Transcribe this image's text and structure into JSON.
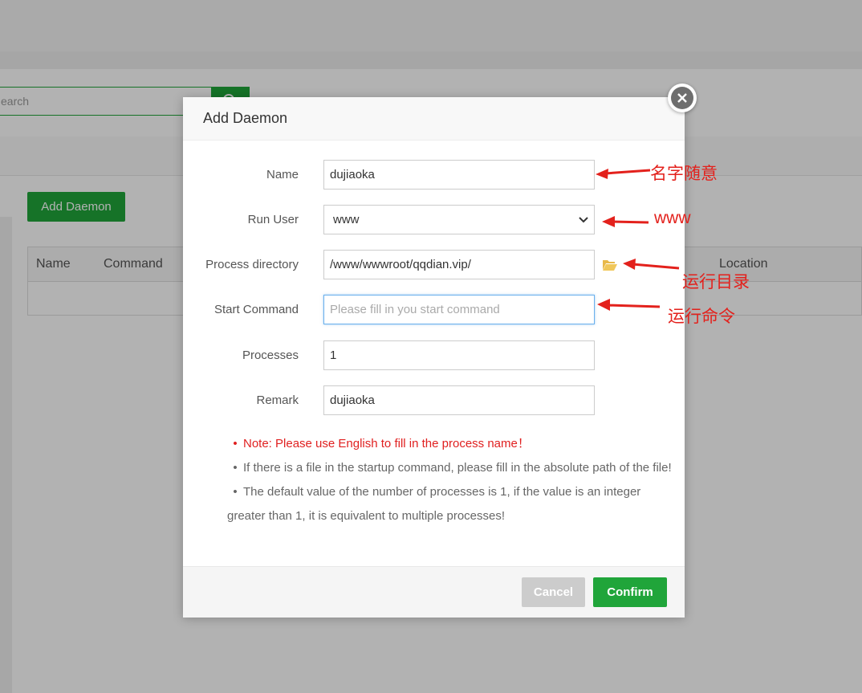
{
  "background": {
    "search_placeholder": "earch",
    "add_daemon_label": "Add Daemon",
    "table_headers": [
      "Name",
      "Command",
      "Location"
    ]
  },
  "modal": {
    "title": "Add Daemon",
    "fields": {
      "name": {
        "label": "Name",
        "value": "dujiaoka"
      },
      "run_user": {
        "label": "Run User",
        "value": "www"
      },
      "process_directory": {
        "label": "Process directory",
        "value": "/www/wwwroot/qqdian.vip/"
      },
      "start_command": {
        "label": "Start Command",
        "value": "",
        "placeholder": "Please fill in you start command"
      },
      "processes": {
        "label": "Processes",
        "value": "1"
      },
      "remark": {
        "label": "Remark",
        "value": "dujiaoka"
      }
    },
    "notes": [
      "Note: Please use English to fill in the process name！",
      "If there is a file in the startup command, please fill in the absolute path of the file!",
      "The default value of the number of processes is 1, if the value is an integer greater than 1, it is equivalent to multiple processes!"
    ],
    "buttons": {
      "cancel": "Cancel",
      "confirm": "Confirm"
    }
  },
  "annotations": {
    "name": "名字随意",
    "run_user": "www",
    "directory": "运行目录",
    "command": "运行命令"
  },
  "colors": {
    "accent": "#20a53a",
    "annotation": "#e3211c",
    "note_warning": "#e02020",
    "folder": "#e8b94a"
  },
  "icons": {
    "close": "close-icon",
    "dropdown": "chevron-down-icon",
    "folder": "folder-open-icon",
    "search": "search-icon"
  }
}
